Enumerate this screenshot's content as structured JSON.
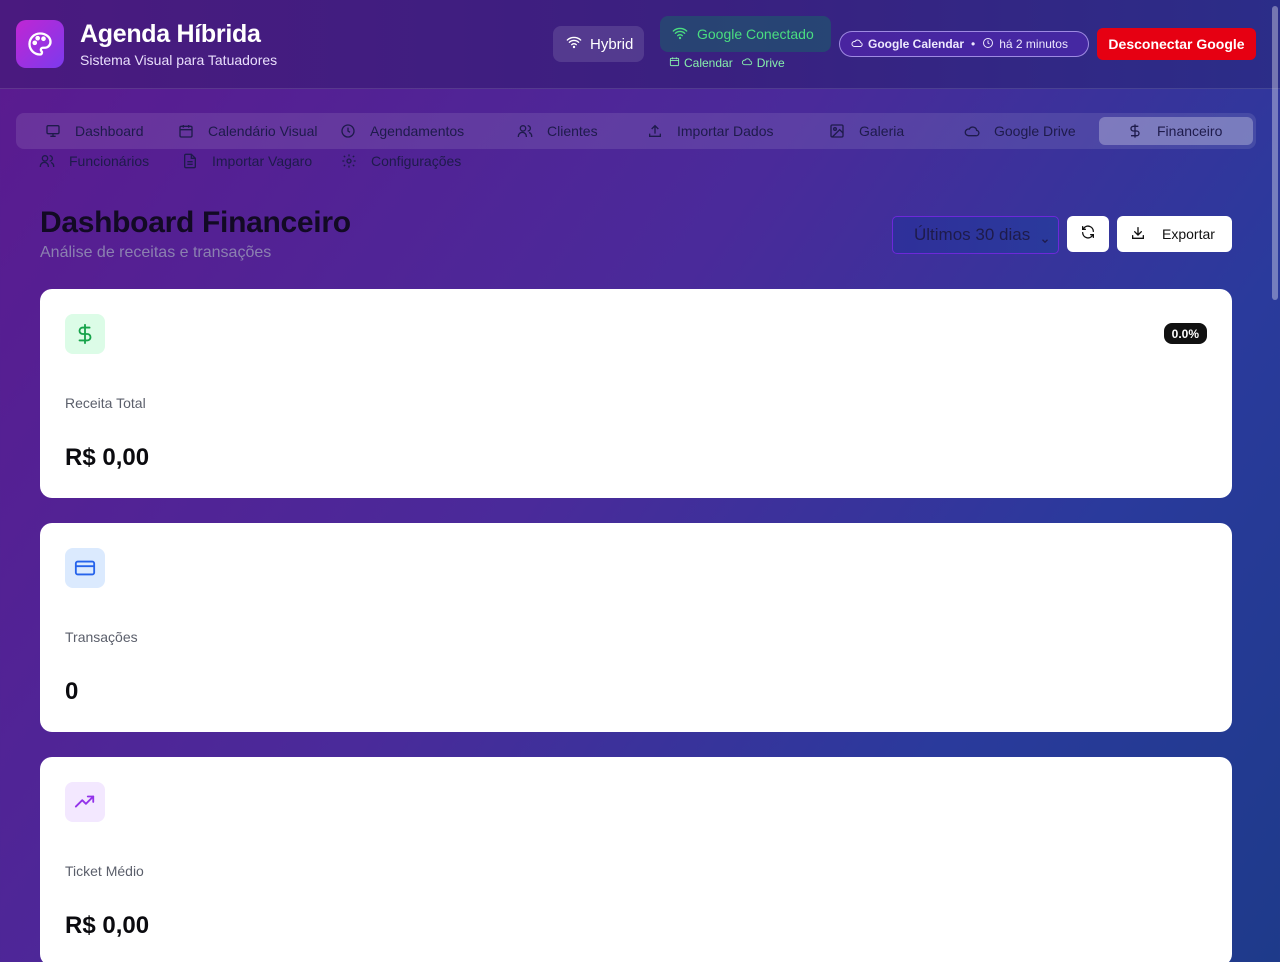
{
  "header": {
    "title": "Agenda Híbrida",
    "subtitle": "Sistema Visual para Tatuadores",
    "mode_label": "Hybrid",
    "google_status": "Google Conectado",
    "google_links": [
      "Calendar",
      "Drive"
    ],
    "sync_service": "Google Calendar",
    "sync_separator": "•",
    "sync_time": "há 2 minutos",
    "disconnect_label": "Desconectar Google"
  },
  "nav": {
    "items": [
      {
        "label": "Dashboard",
        "icon": "monitor-icon"
      },
      {
        "label": "Calendário Visual",
        "icon": "calendar-icon"
      },
      {
        "label": "Agendamentos",
        "icon": "clock-icon"
      },
      {
        "label": "Clientes",
        "icon": "users-icon"
      },
      {
        "label": "Importar Dados",
        "icon": "upload-icon"
      },
      {
        "label": "Galeria",
        "icon": "image-icon"
      },
      {
        "label": "Google Drive",
        "icon": "cloud-icon"
      },
      {
        "label": "Financeiro",
        "icon": "dollar-icon",
        "active": true
      },
      {
        "label": "Funcionários",
        "icon": "users-icon"
      },
      {
        "label": "Importar Vagaro",
        "icon": "file-icon"
      },
      {
        "label": "Configurações",
        "icon": "settings-icon"
      }
    ]
  },
  "page": {
    "title": "Dashboard Financeiro",
    "subtitle": "Análise de receitas e transações",
    "period": "Últimos 30 dias",
    "export_label": "Exportar"
  },
  "cards": [
    {
      "label": "Receita Total",
      "value": "R$ 0,00",
      "badge": "0.0%",
      "icon": "dollar-icon",
      "icon_color": "#16a34a",
      "icon_bg": "#dcfce7"
    },
    {
      "label": "Transações",
      "value": "0",
      "icon": "credit-card-icon",
      "icon_color": "#2563eb",
      "icon_bg": "#dbeafe"
    },
    {
      "label": "Ticket Médio",
      "value": "R$ 0,00",
      "icon": "trending-up-icon",
      "icon_color": "#9333ea",
      "icon_bg": "#f3e8ff"
    }
  ],
  "colors": {
    "disconnect": "#e60012",
    "google_connected": "#4ade80",
    "title": "#120a24"
  }
}
